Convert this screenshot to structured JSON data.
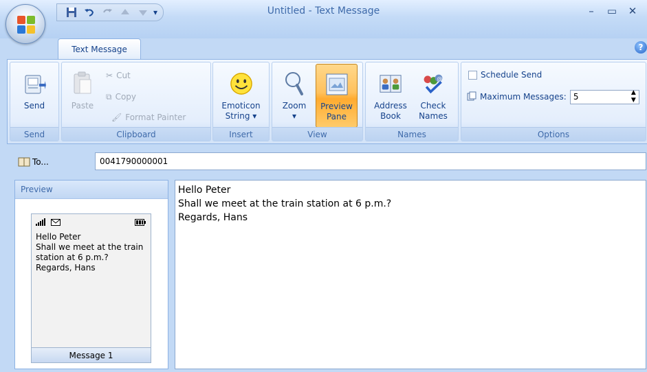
{
  "window": {
    "title": "Untitled - Text Message"
  },
  "tabs": [
    {
      "label": "Text Message",
      "active": true
    }
  ],
  "help_label": "?",
  "ribbon": {
    "send": {
      "button": "Send",
      "group": "Send"
    },
    "clipboard": {
      "paste": "Paste",
      "cut": "Cut",
      "copy": "Copy",
      "format_painter": "Format Painter",
      "group": "Clipboard"
    },
    "insert": {
      "emoticon_line1": "Emoticon",
      "emoticon_line2": "String ▾",
      "group": "Insert"
    },
    "view": {
      "zoom": "Zoom",
      "zoom_arrow": "▾",
      "preview_line1": "Preview",
      "preview_line2": "Pane",
      "group": "View"
    },
    "names": {
      "address_line1": "Address",
      "address_line2": "Book",
      "check_line1": "Check",
      "check_line2": "Names",
      "group": "Names"
    },
    "options": {
      "schedule_send": "Schedule Send",
      "max_messages_label": "Maximum Messages:",
      "max_messages_value": "5",
      "group": "Options"
    }
  },
  "to": {
    "button": "To...",
    "value": "0041790000001"
  },
  "preview": {
    "header": "Preview",
    "phone_text": "Hello Peter\nShall we meet at the train station at 6 p.m.?\nRegards, Hans",
    "footer": "Message 1"
  },
  "message": {
    "body": "Hello Peter\nShall we meet at the train station at 6 p.m.?\nRegards, Hans"
  },
  "colors": {
    "ribbon_blue": "#c2d9f5",
    "accent_text": "#15428b",
    "pressed_orange": "#ffc15d"
  }
}
